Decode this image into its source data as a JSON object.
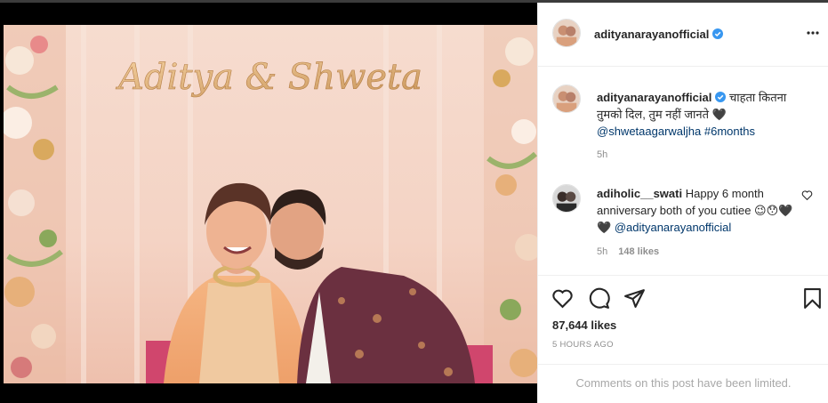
{
  "post": {
    "username": "adityanarayanofficial",
    "verified": true,
    "more_icon": "more-horizontal-icon",
    "photo_sign_text": "Aditya & Shweta"
  },
  "caption": {
    "username": "adityanarayanofficial",
    "text": "चाहता कितना तुमको दिल, तुम नहीं जानते 🖤",
    "mention": "@shwetaagarwaljha",
    "hashtag": "#6months",
    "time": "5h"
  },
  "comment": {
    "username": "adiholic__swati",
    "text": "Happy 6 month anniversary both of you cutiee 😉😯🖤🖤",
    "mention": "@adityanarayanofficial",
    "time": "5h",
    "likes": "148 likes"
  },
  "actions": {
    "like_icon": "heart-icon",
    "comment_icon": "comment-icon",
    "share_icon": "paper-plane-icon",
    "save_icon": "bookmark-icon"
  },
  "likes_count": "87,644 likes",
  "post_time": "5 HOURS AGO",
  "comments_limited": "Comments on this post have been limited.",
  "colors": {
    "text": "#262626",
    "secondary": "#8e8e8e",
    "link": "#00376b",
    "verified": "#3897f0",
    "border": "#efefef"
  }
}
